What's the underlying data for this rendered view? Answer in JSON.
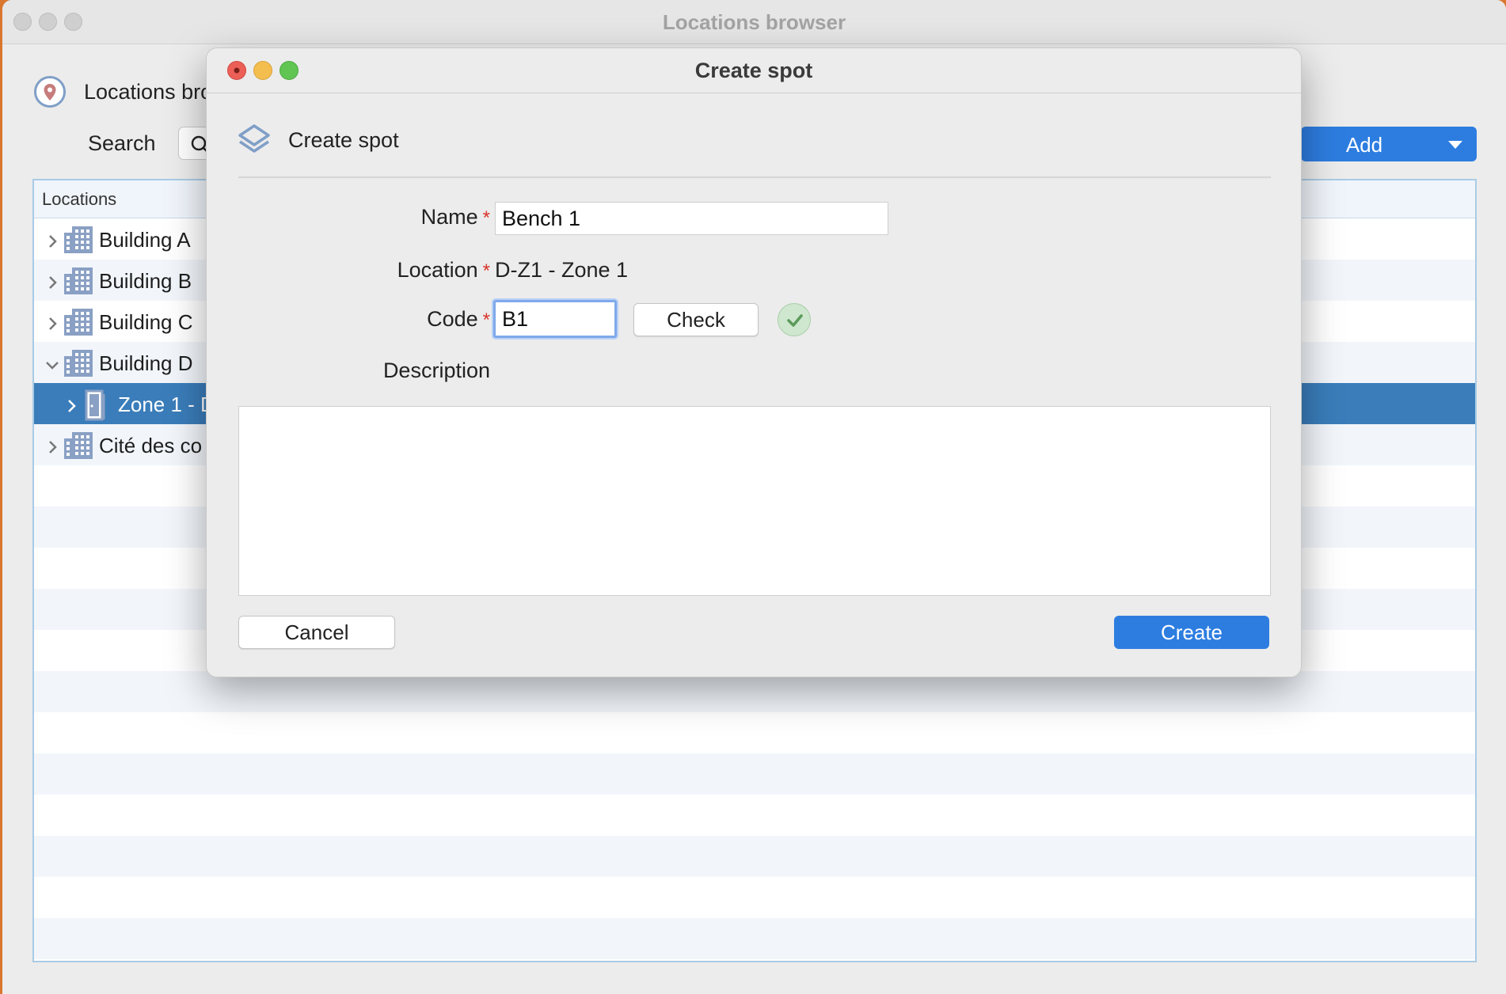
{
  "window": {
    "title": "Locations browser",
    "header_title": "Locations bro",
    "search_label": "Search",
    "add_label": "Add",
    "tree_column": "Locations",
    "tree_rows": [
      {
        "label": "Building A",
        "expanded": false
      },
      {
        "label": "Building B",
        "expanded": false
      },
      {
        "label": "Building C",
        "expanded": false
      },
      {
        "label": "Building D",
        "expanded": true
      },
      {
        "label": "Zone 1 - D",
        "expanded": false,
        "selected": true
      },
      {
        "label": "Cité des co",
        "expanded": false
      }
    ]
  },
  "dialog": {
    "title": "Create spot",
    "header_title": "Create spot",
    "name_label": "Name",
    "name_value": "Bench 1",
    "location_label": "Location",
    "location_value": "D-Z1 - Zone 1",
    "code_label": "Code",
    "code_value": "B1",
    "check_label": "Check",
    "description_label": "Description",
    "description_value": "",
    "required_mark": "*",
    "cancel_label": "Cancel",
    "create_label": "Create"
  },
  "colors": {
    "accent": "#2d7de0",
    "selection": "#3a7dba",
    "required": "#d9342b",
    "close": "#ec5f57",
    "minimize": "#f4be4f",
    "zoom": "#61c554"
  },
  "icons": {
    "header": "location-pin-icon",
    "search": "search-icon",
    "building": "building-icon",
    "zone": "door-icon",
    "dialog_header": "layers-icon",
    "check_status": "checkmark-icon"
  }
}
